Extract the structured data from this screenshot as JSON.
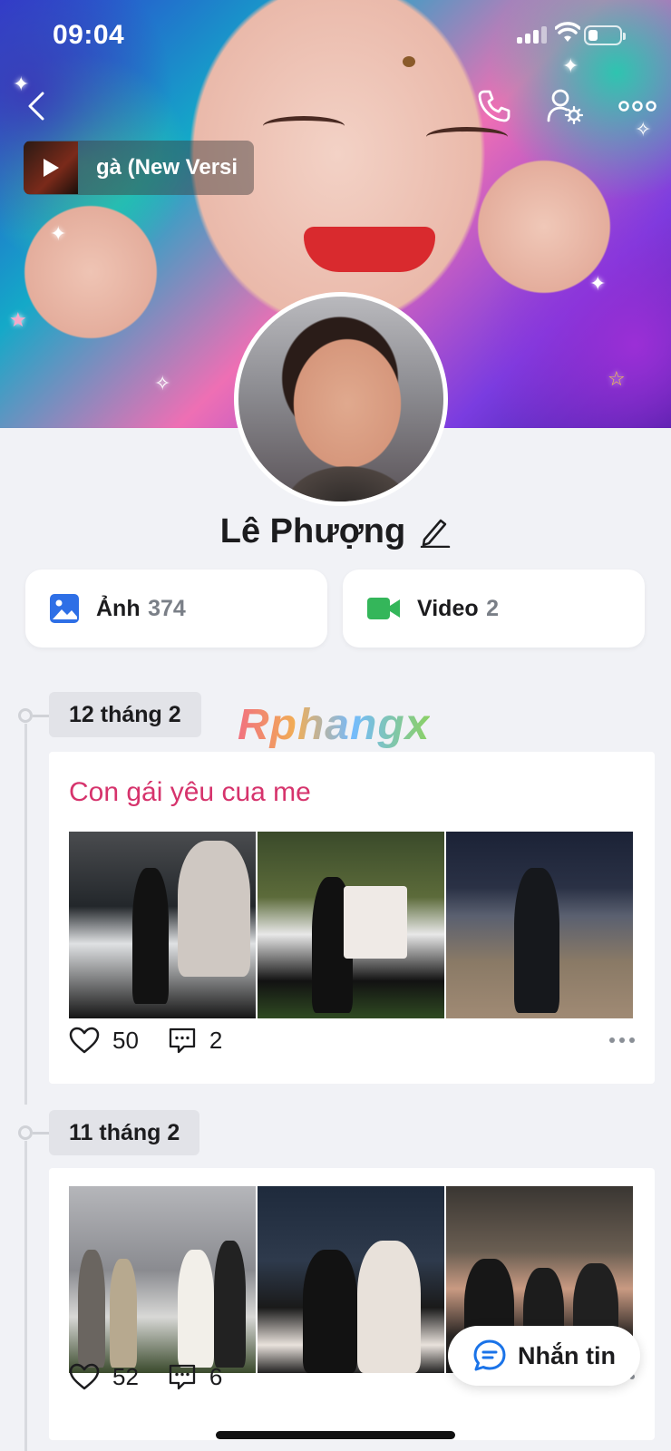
{
  "status": {
    "time": "09:04"
  },
  "header": {
    "music_title": "gà (New Versi",
    "icons": [
      "back-icon",
      "phone-icon",
      "user-settings-icon",
      "more-icon",
      "play-icon"
    ]
  },
  "profile": {
    "name": "Lê Phượng"
  },
  "media": {
    "photos_label": "Ảnh",
    "photos_count": "374",
    "videos_label": "Video",
    "videos_count": "2"
  },
  "watermark": "Rphangx",
  "posts": [
    {
      "date": "12 tháng 2",
      "caption": "Con gái yêu cua me",
      "likes": "50",
      "comments": "2"
    },
    {
      "date": "11 tháng 2",
      "caption": "",
      "likes": "52",
      "comments": "6"
    }
  ],
  "message_button": {
    "label": "Nhắn tin"
  },
  "colors": {
    "accent_blue": "#1a73e8",
    "caption_pink": "#d6336c",
    "video_green": "#34b65a",
    "photo_blue": "#2e6fe6"
  }
}
